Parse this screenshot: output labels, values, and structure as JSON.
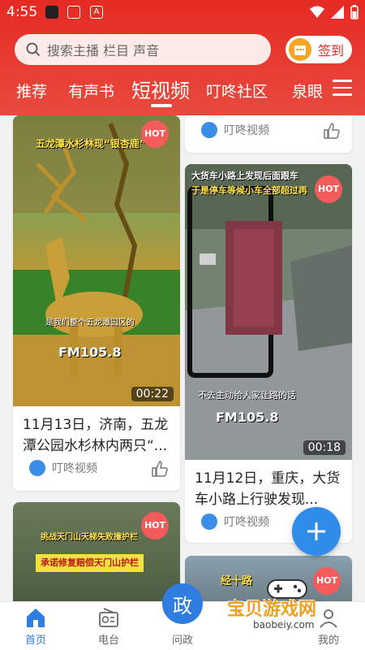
{
  "status_bar": {
    "time": "4:55"
  },
  "search": {
    "placeholder": "搜索主播 栏目 声音"
  },
  "signin": {
    "label": "签到"
  },
  "tabs": [
    {
      "label": "推荐",
      "active": false
    },
    {
      "label": "有声书",
      "active": false
    },
    {
      "label": "短视频",
      "active": true
    },
    {
      "label": "叮咚社区",
      "active": false
    },
    {
      "label": "泉眼",
      "active": false
    }
  ],
  "cards": {
    "card1": {
      "hot": "HOT",
      "duration": "00:22",
      "title": "11月13日，济南，五龙潭公园水杉林内两只“...",
      "overlay_title": "五龙潭水杉林现“银杏鹿”",
      "overlay_caption": "是我们整个五龙潭园区的",
      "overlay_brand": "FM105.8",
      "source": "叮咚视频"
    },
    "card2": {
      "source": "叮咚视频"
    },
    "card3": {
      "hot": "HOT",
      "duration": "00:18",
      "title": "11月12日，重庆，大货车小路上行驶发现...",
      "overlay_title": "大货车小路上发现后面跟车",
      "overlay_subtitle": "于是停车等候小车全部超过再",
      "overlay_caption": "不去主动给人家让路的话",
      "overlay_brand": "FM105.8",
      "source": "叮咚视频"
    },
    "card4": {
      "hot": "HOT",
      "overlay_title": "挑战天门山天梯失败撞护栏",
      "overlay_band": "承诺修复赔偿天门山护栏"
    },
    "card5": {
      "hot": "HOT",
      "overlay_title": "经十路"
    }
  },
  "bottom_nav": [
    {
      "label": "首页",
      "active": true
    },
    {
      "label": "电台",
      "active": false
    },
    {
      "label": "问政",
      "active": false
    },
    {
      "label": "",
      "active": false
    },
    {
      "label": "我的",
      "active": false
    }
  ],
  "politics_icon_text": "政",
  "watermark": {
    "text": "宝贝游戏网",
    "url": "baobeiy.com"
  },
  "colors": {
    "primary_red": "#e52a22",
    "accent_blue": "#2f7de1",
    "hot": "#f45b5b"
  }
}
